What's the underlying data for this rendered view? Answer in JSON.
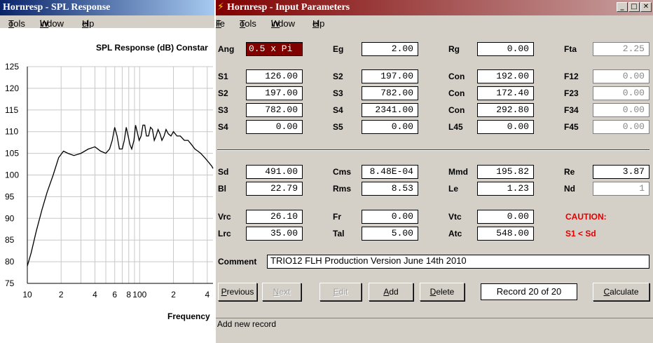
{
  "left_window": {
    "title": "Hornresp - SPL Response",
    "menu": [
      {
        "label": "Tools",
        "u": "T",
        "rest": "ools"
      },
      {
        "label": "Window",
        "u": "W",
        "rest": "indow"
      },
      {
        "label": "Help",
        "u": "H",
        "rest": "elp"
      }
    ],
    "chart_heading": "SPL Response (dB)  Constar",
    "colors": {
      "curve": "#000000",
      "grid": "#c8c8c8",
      "background": "#ffffff"
    }
  },
  "chart_data": {
    "type": "line",
    "title": "SPL Response (dB)  Constar",
    "xlabel": "Frequency",
    "ylabel": "SPL Response (dB)",
    "x_scale": "log",
    "xlim": [
      10,
      450
    ],
    "ylim": [
      75,
      125
    ],
    "grid": true,
    "y_ticks": [
      75,
      80,
      85,
      90,
      95,
      100,
      105,
      110,
      115,
      120,
      125
    ],
    "x_tick_labels": [
      {
        "value": 10,
        "label": "10"
      },
      {
        "value": 20,
        "label": "2"
      },
      {
        "value": 40,
        "label": "4"
      },
      {
        "value": 60,
        "label": "6"
      },
      {
        "value": 80,
        "label": "8"
      },
      {
        "value": 100,
        "label": "100"
      },
      {
        "value": 200,
        "label": "2"
      },
      {
        "value": 400,
        "label": "4"
      }
    ],
    "series": [
      {
        "x": [
          10,
          10.8,
          12,
          13.5,
          15,
          17,
          19,
          21,
          23,
          26,
          30,
          35,
          40,
          45,
          50,
          54,
          57,
          60,
          63,
          66,
          70,
          73,
          76,
          79,
          82,
          85,
          89,
          92,
          95,
          99,
          103,
          107,
          111,
          115,
          120,
          125,
          130,
          135,
          140,
          146,
          152,
          158,
          165,
          172,
          180,
          190,
          200,
          215,
          230,
          250,
          270,
          290,
          310,
          330,
          350,
          380,
          410,
          440,
          450
        ],
        "y": [
          79,
          82,
          87,
          92,
          96,
          100,
          104,
          105.5,
          105,
          104.5,
          105,
          106,
          106.5,
          105.5,
          105,
          106,
          108,
          111,
          109,
          106,
          106,
          108,
          111,
          109,
          107,
          106,
          108,
          111.5,
          110,
          108,
          109,
          111.5,
          111.5,
          109,
          109,
          111,
          110.5,
          108,
          109,
          110.5,
          109.5,
          108,
          109,
          110.5,
          109.5,
          109,
          110,
          109,
          109,
          108,
          108,
          107,
          106,
          105.5,
          105,
          104,
          103,
          102,
          101.5
        ]
      }
    ]
  },
  "right_window": {
    "title": "Hornresp - Input Parameters",
    "window_buttons": {
      "minimize": "_",
      "maximize": "□",
      "close": "✕"
    },
    "menu": [
      {
        "label": "File",
        "u": "F",
        "rest": "ile"
      },
      {
        "label": "Tools",
        "u": "T",
        "rest": "ools"
      },
      {
        "label": "Window",
        "u": "W",
        "rest": "indow"
      },
      {
        "label": "Help",
        "u": "H",
        "rest": "elp"
      }
    ],
    "params": [
      {
        "label": "Ang",
        "value": "0.5 x Pi",
        "state": "selected"
      },
      {
        "label": "Eg",
        "value": "2.00"
      },
      {
        "label": "Rg",
        "value": "0.00"
      },
      {
        "label": "Fta",
        "value": "2.25",
        "state": "disabled"
      },
      {
        "label": "S1",
        "value": "126.00"
      },
      {
        "label": "S2",
        "value": "197.00"
      },
      {
        "label": "Con",
        "value": "192.00"
      },
      {
        "label": "F12",
        "value": "0.00",
        "state": "disabled"
      },
      {
        "label": "S2",
        "value": "197.00"
      },
      {
        "label": "S3",
        "value": "782.00"
      },
      {
        "label": "Con",
        "value": "172.40"
      },
      {
        "label": "F23",
        "value": "0.00",
        "state": "disabled"
      },
      {
        "label": "S3",
        "value": "782.00"
      },
      {
        "label": "S4",
        "value": "2341.00"
      },
      {
        "label": "Con",
        "value": "292.80"
      },
      {
        "label": "F34",
        "value": "0.00",
        "state": "disabled"
      },
      {
        "label": "S4",
        "value": "0.00"
      },
      {
        "label": "S5",
        "value": "0.00"
      },
      {
        "label": "L45",
        "value": "0.00"
      },
      {
        "label": "F45",
        "value": "0.00",
        "state": "disabled"
      },
      {
        "label": "Sd",
        "value": "491.00"
      },
      {
        "label": "Cms",
        "value": "8.48E-04"
      },
      {
        "label": "Mmd",
        "value": "195.82"
      },
      {
        "label": "Re",
        "value": "3.87"
      },
      {
        "label": "Bl",
        "value": "22.79"
      },
      {
        "label": "Rms",
        "value": "8.53"
      },
      {
        "label": "Le",
        "value": "1.23"
      },
      {
        "label": "Nd",
        "value": "1",
        "state": "disabled"
      },
      {
        "label": "Vrc",
        "value": "26.10"
      },
      {
        "label": "Fr",
        "value": "0.00"
      },
      {
        "label": "Vtc",
        "value": "0.00"
      },
      {
        "label": "Lrc",
        "value": "35.00"
      },
      {
        "label": "Tal",
        "value": "5.00"
      },
      {
        "label": "Atc",
        "value": "548.00"
      }
    ],
    "caution_title": "CAUTION:",
    "caution_text": "S1 < Sd",
    "comment_label": "Comment",
    "comment_value": "TRIO12 FLH Production Version June 14th 2010",
    "record_text": "Record 20 of 20",
    "buttons": [
      {
        "label": "Previous",
        "u": "P",
        "rest": "revious",
        "enabled": true
      },
      {
        "label": "Next",
        "u": "N",
        "rest": "ext",
        "enabled": false
      },
      {
        "label": "Edit",
        "u": "E",
        "rest": "dit",
        "enabled": false
      },
      {
        "label": "Add",
        "u": "A",
        "rest": "dd",
        "enabled": true
      },
      {
        "label": "Delete",
        "u": "D",
        "rest": "elete",
        "enabled": true
      },
      {
        "label": "Calculate",
        "u": "C",
        "rest": "alculate",
        "enabled": true
      }
    ],
    "status_text": "Add new record"
  }
}
